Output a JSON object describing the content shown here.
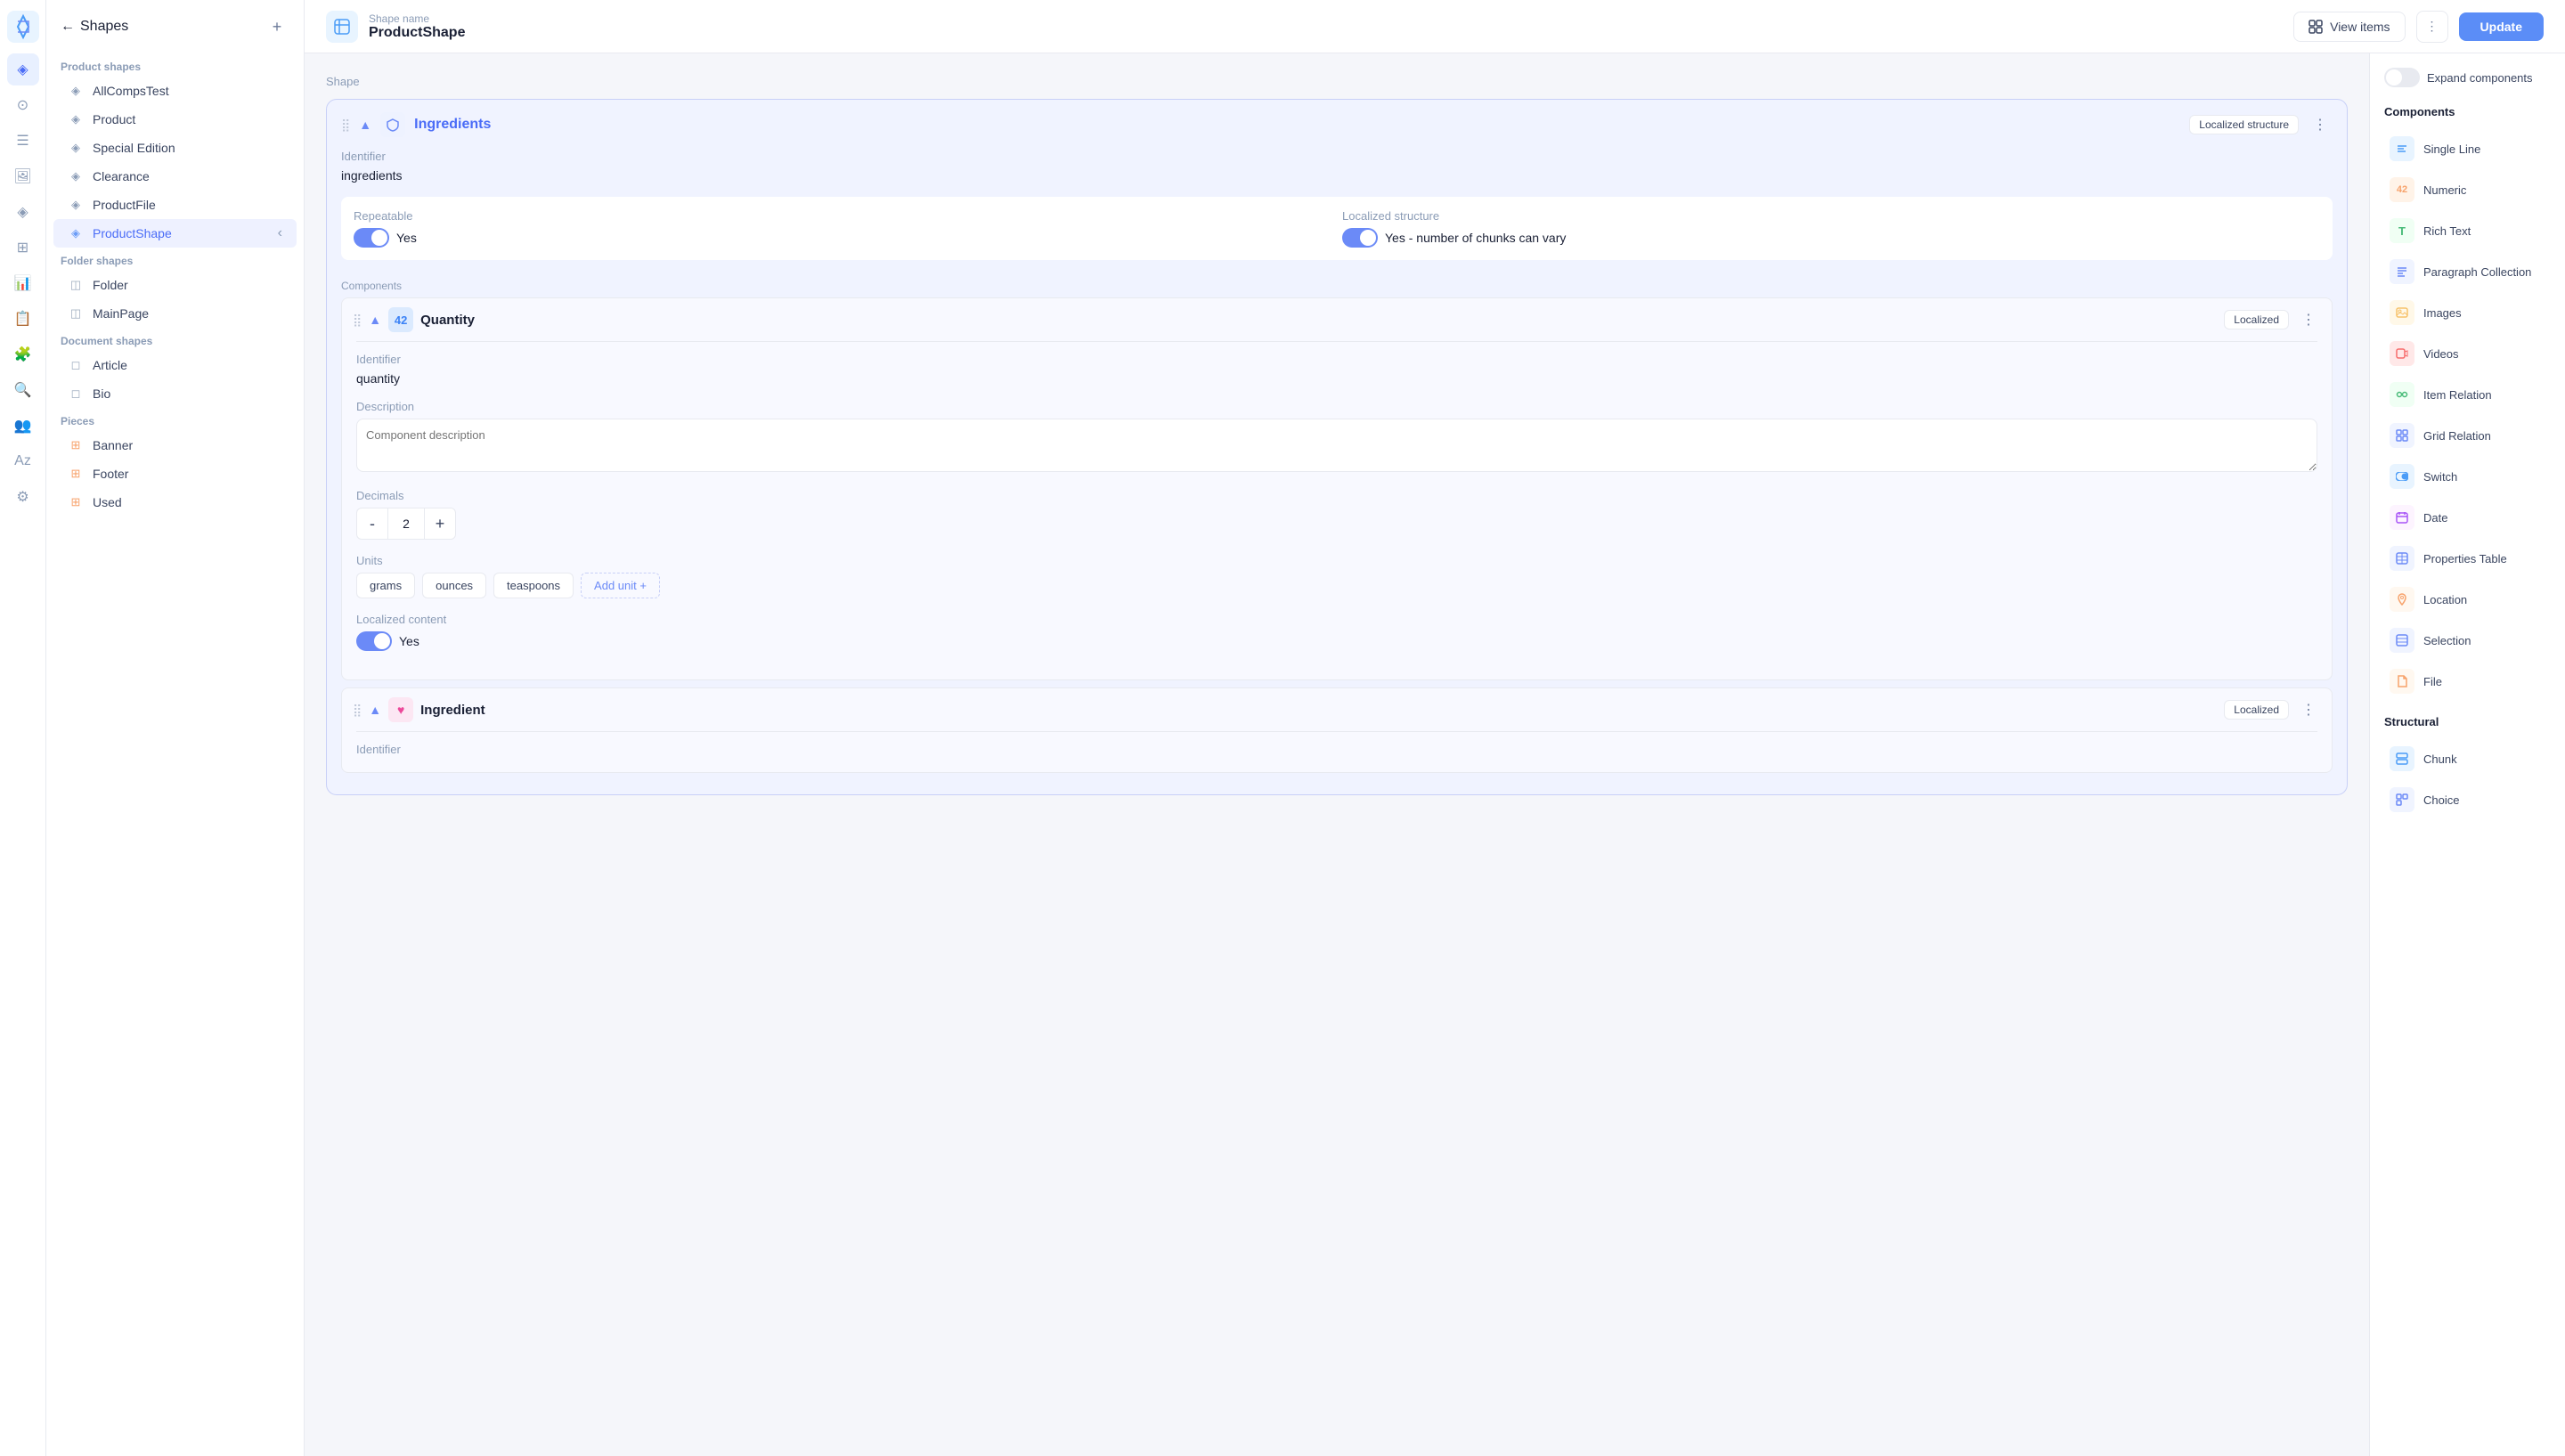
{
  "iconBar": {
    "logo": "🌿"
  },
  "sidebar": {
    "title": "Shapes",
    "productShapes": {
      "label": "Product shapes",
      "items": [
        {
          "name": "AllCompsTest",
          "icon": "◈"
        },
        {
          "name": "Product",
          "icon": "◈"
        },
        {
          "name": "Special Edition",
          "icon": "◈"
        },
        {
          "name": "Clearance",
          "icon": "◈"
        },
        {
          "name": "ProductFile",
          "icon": "◈"
        },
        {
          "name": "ProductShape",
          "icon": "◈",
          "active": true
        }
      ]
    },
    "folderShapes": {
      "label": "Folder shapes",
      "items": [
        {
          "name": "Folder",
          "icon": "◫"
        },
        {
          "name": "MainPage",
          "icon": "◫"
        }
      ]
    },
    "documentShapes": {
      "label": "Document shapes",
      "items": [
        {
          "name": "Article",
          "icon": "◻"
        },
        {
          "name": "Bio",
          "icon": "◻"
        }
      ]
    },
    "pieces": {
      "label": "Pieces",
      "items": [
        {
          "name": "Banner",
          "icon": "⊞"
        },
        {
          "name": "Footer",
          "icon": "⊞"
        },
        {
          "name": "Used",
          "icon": "⊞"
        }
      ]
    }
  },
  "topbar": {
    "shapeNameLabel": "Shape name",
    "shapeNameValue": "ProductShape",
    "viewItemsLabel": "View items",
    "updateLabel": "Update"
  },
  "main": {
    "sectionLabel": "Shape",
    "ingredients": {
      "title": "Ingredients",
      "badge": "Localized structure",
      "identifier": {
        "label": "Identifier",
        "value": "ingredients"
      },
      "repeatable": {
        "label": "Repeatable",
        "value": "Yes",
        "on": true
      },
      "localizedStructure": {
        "label": "Localized structure",
        "value": "Yes - number of chunks can vary",
        "on": true
      },
      "componentsLabel": "Components",
      "quantity": {
        "title": "Quantity",
        "badge": "Localized",
        "identifier": {
          "label": "Identifier",
          "value": "quantity"
        },
        "description": {
          "label": "Description",
          "placeholder": "Component description"
        },
        "decimals": {
          "label": "Decimals",
          "value": "2",
          "minus": "-",
          "plus": "+"
        },
        "units": {
          "label": "Units",
          "items": [
            "grams",
            "ounces",
            "teaspoons"
          ],
          "addLabel": "Add unit +"
        },
        "localizedContent": {
          "label": "Localized content",
          "value": "Yes",
          "on": true
        }
      },
      "ingredient": {
        "title": "Ingredient",
        "badge": "Localized",
        "identifier": {
          "label": "Identifier",
          "value": ""
        }
      }
    }
  },
  "rightPanel": {
    "expandLabel": "Expand components",
    "componentsTitle": "Components",
    "components": [
      {
        "name": "Single Line",
        "iconClass": "comp-icon-single-line",
        "icon": "≡"
      },
      {
        "name": "Numeric",
        "iconClass": "comp-icon-numeric",
        "icon": "42"
      },
      {
        "name": "Rich Text",
        "iconClass": "comp-icon-rich-text",
        "icon": "T"
      },
      {
        "name": "Paragraph Collection",
        "iconClass": "comp-icon-paragraph",
        "icon": "¶"
      },
      {
        "name": "Images",
        "iconClass": "comp-icon-images",
        "icon": "🖼"
      },
      {
        "name": "Videos",
        "iconClass": "comp-icon-videos",
        "icon": "▶"
      },
      {
        "name": "Item Relation",
        "iconClass": "comp-icon-item-rel",
        "icon": "↗"
      },
      {
        "name": "Grid Relation",
        "iconClass": "comp-icon-grid-rel",
        "icon": "⊞"
      },
      {
        "name": "Switch",
        "iconClass": "comp-icon-switch",
        "icon": "⊙"
      },
      {
        "name": "Date",
        "iconClass": "comp-icon-date",
        "icon": "📅"
      },
      {
        "name": "Properties Table",
        "iconClass": "comp-icon-properties",
        "icon": "⊟"
      },
      {
        "name": "Location",
        "iconClass": "comp-icon-location",
        "icon": "📍"
      },
      {
        "name": "Selection",
        "iconClass": "comp-icon-selection",
        "icon": "⊠"
      },
      {
        "name": "File",
        "iconClass": "comp-icon-file",
        "icon": "📄"
      }
    ],
    "structuralTitle": "Structural",
    "structural": [
      {
        "name": "Chunk",
        "iconClass": "comp-icon-chunk",
        "icon": "⊟"
      },
      {
        "name": "Choice",
        "iconClass": "comp-icon-choice",
        "icon": "⊞"
      }
    ]
  }
}
